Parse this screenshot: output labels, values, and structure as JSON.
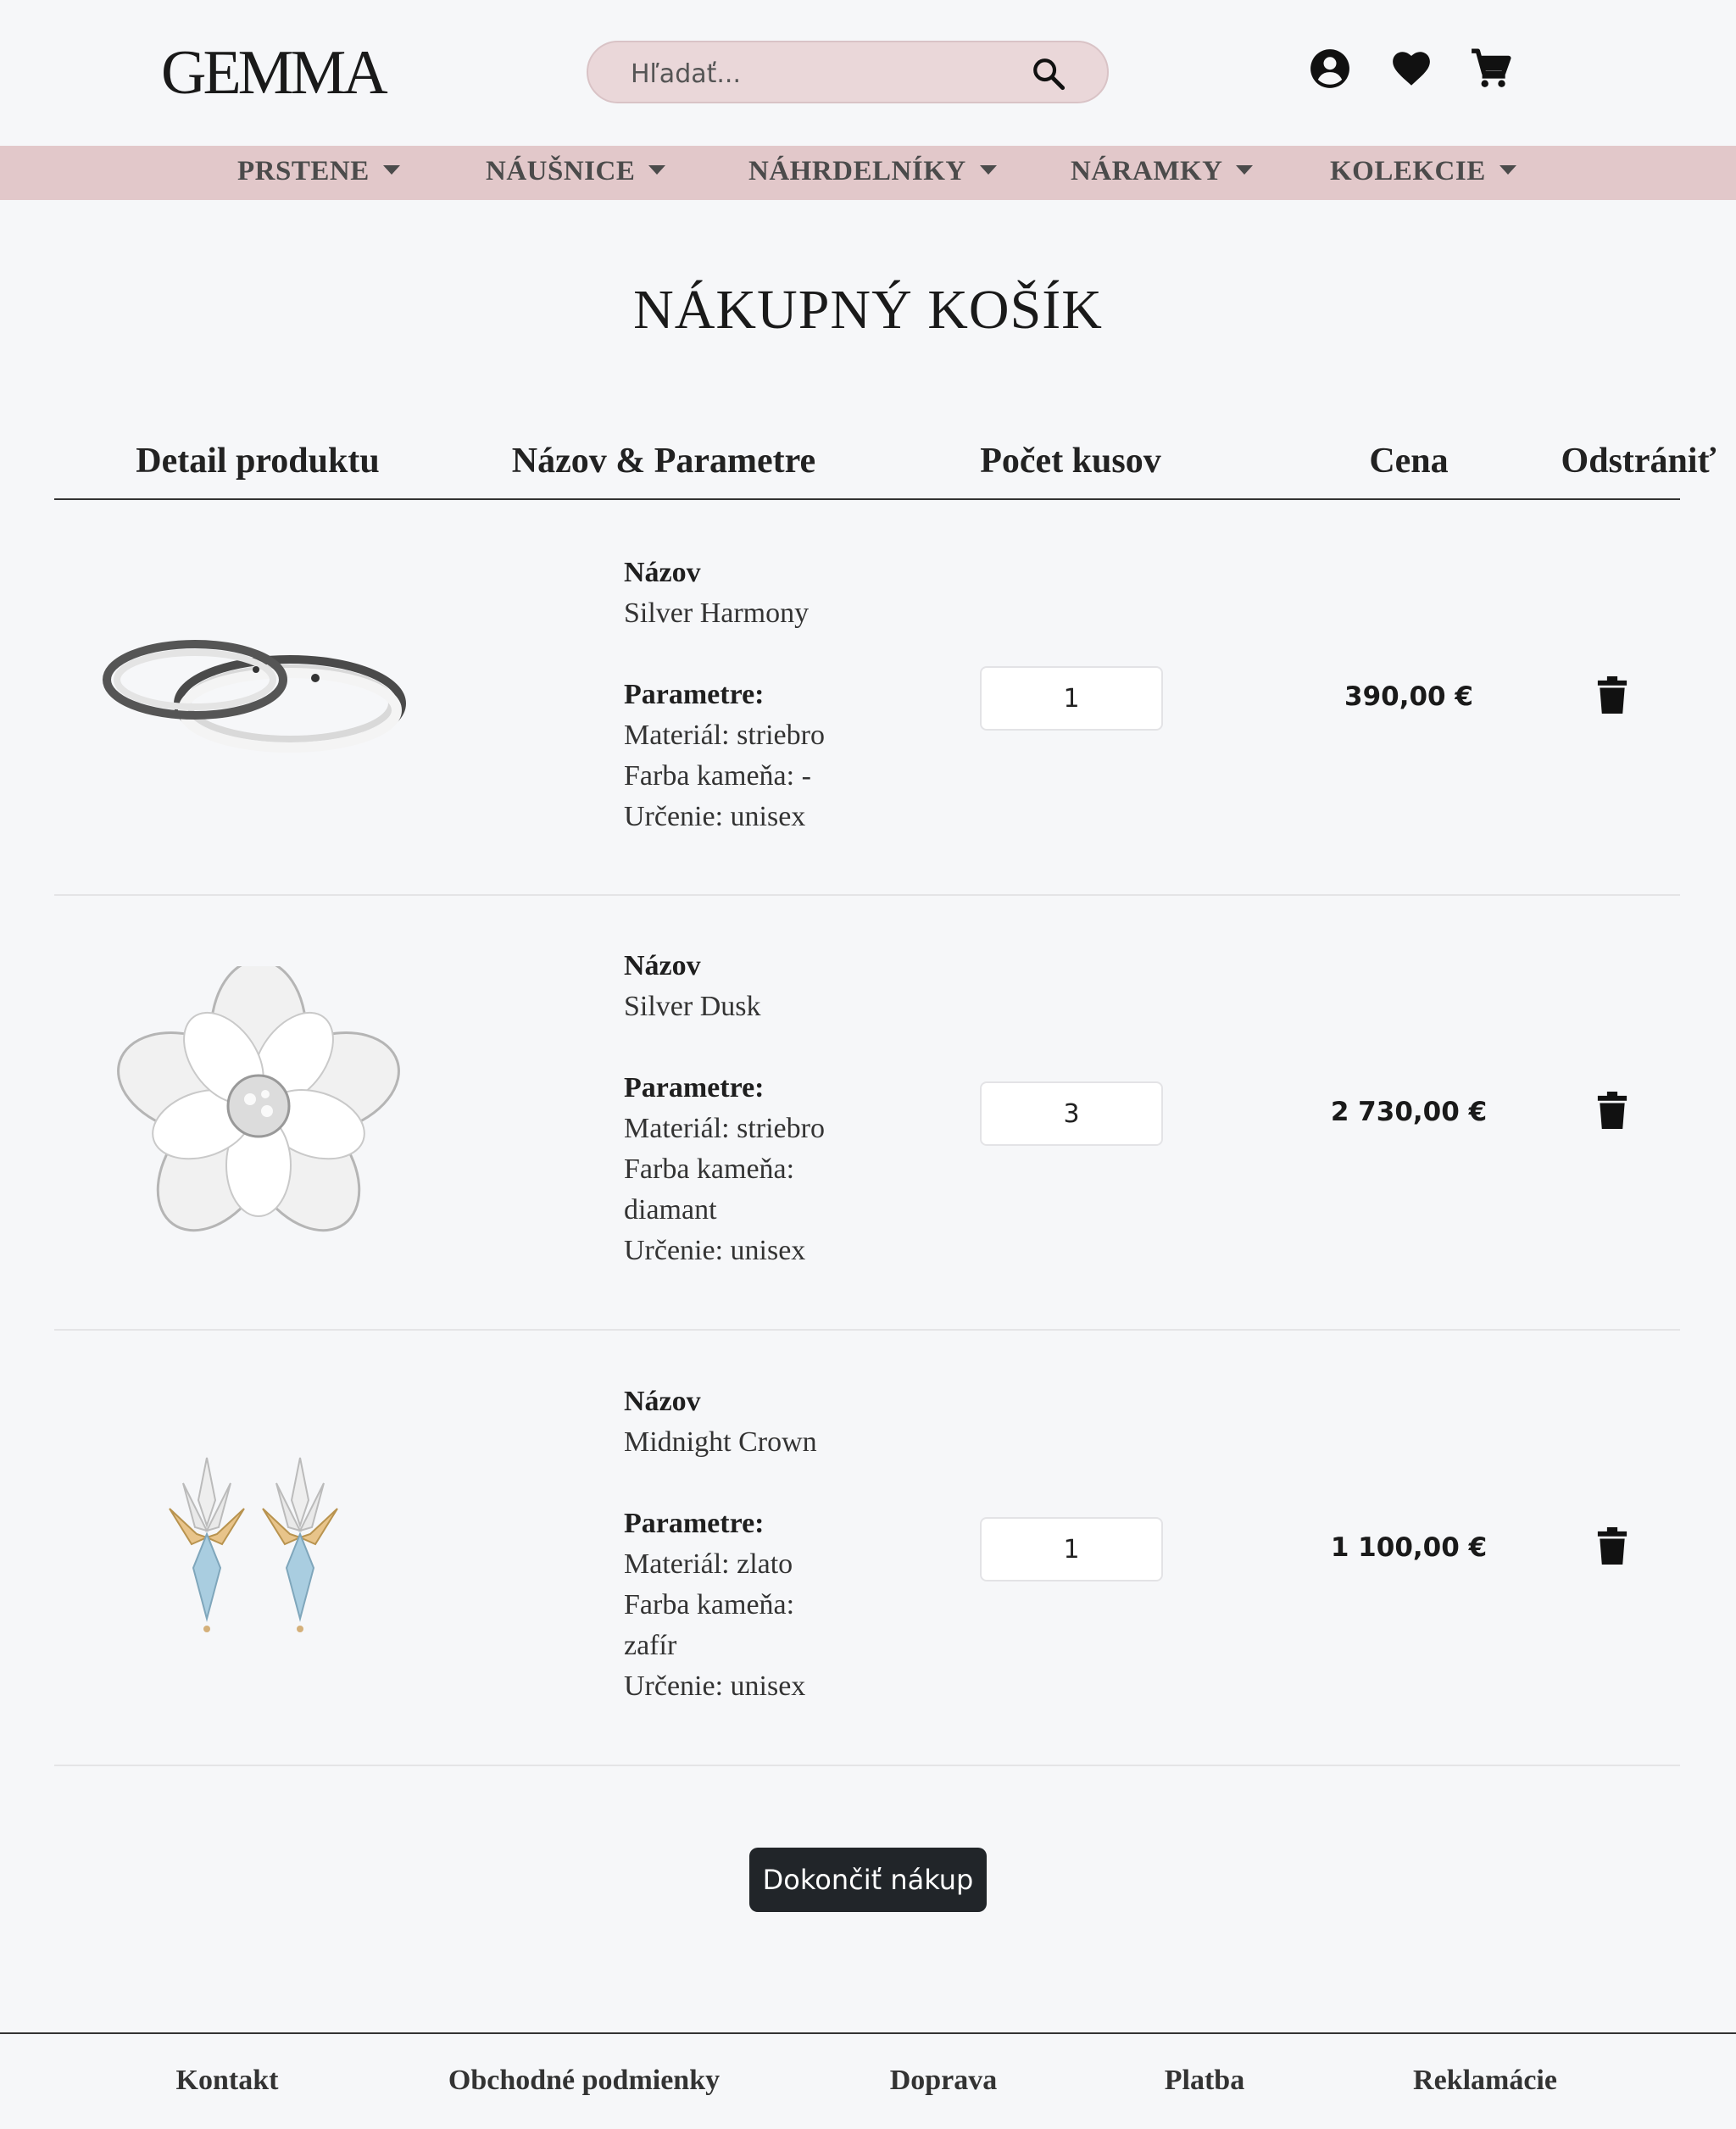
{
  "brand": {
    "logo": "GEMMA"
  },
  "search": {
    "placeholder": "Hľadať..."
  },
  "header_icons": [
    "account-icon",
    "heart-icon",
    "cart-icon"
  ],
  "nav": {
    "items": [
      {
        "label": "PRSTENE"
      },
      {
        "label": "NÁUŠNICE"
      },
      {
        "label": "NÁHRDELNÍKY"
      },
      {
        "label": "NÁRAMKY"
      },
      {
        "label": "KOLEKCIE"
      }
    ]
  },
  "page": {
    "title": "NÁKUPNÝ KOŠÍK"
  },
  "table": {
    "headers": [
      "Detail produktu",
      "Názov & Parametre",
      "Počet kusov",
      "Cena",
      "Odstrániť"
    ]
  },
  "labels": {
    "name": "Názov",
    "params": "Parametre:"
  },
  "cart": [
    {
      "name": "Silver Harmony",
      "image": "silver-rings",
      "params": [
        "Materiál: striebro",
        "Farba kameňa: -",
        "Určenie: unisex"
      ],
      "quantity": "1",
      "price": "390,00 €"
    },
    {
      "name": "Silver Dusk",
      "image": "silver-flower-brooch",
      "params": [
        "Materiál: striebro",
        "Farba kameňa:",
        "diamant",
        "Určenie: unisex"
      ],
      "quantity": "3",
      "price": "2 730,00 €"
    },
    {
      "name": "Midnight Crown",
      "image": "gold-sapphire-earrings",
      "params": [
        "Materiál: zlato",
        "Farba kameňa:",
        "zafír",
        "Určenie: unisex"
      ],
      "quantity": "1",
      "price": "1 100,00 €"
    }
  ],
  "actions": {
    "finish": "Dokončiť nákup"
  },
  "footer": {
    "links": [
      "Kontakt",
      "Obchodné podmienky",
      "Doprava",
      "Platba",
      "Reklamácie"
    ]
  },
  "colors": {
    "background": "#f6f7f9",
    "nav_bg": "#e2c8ca",
    "search_bg": "#ead7d9",
    "dark": "#212529"
  }
}
